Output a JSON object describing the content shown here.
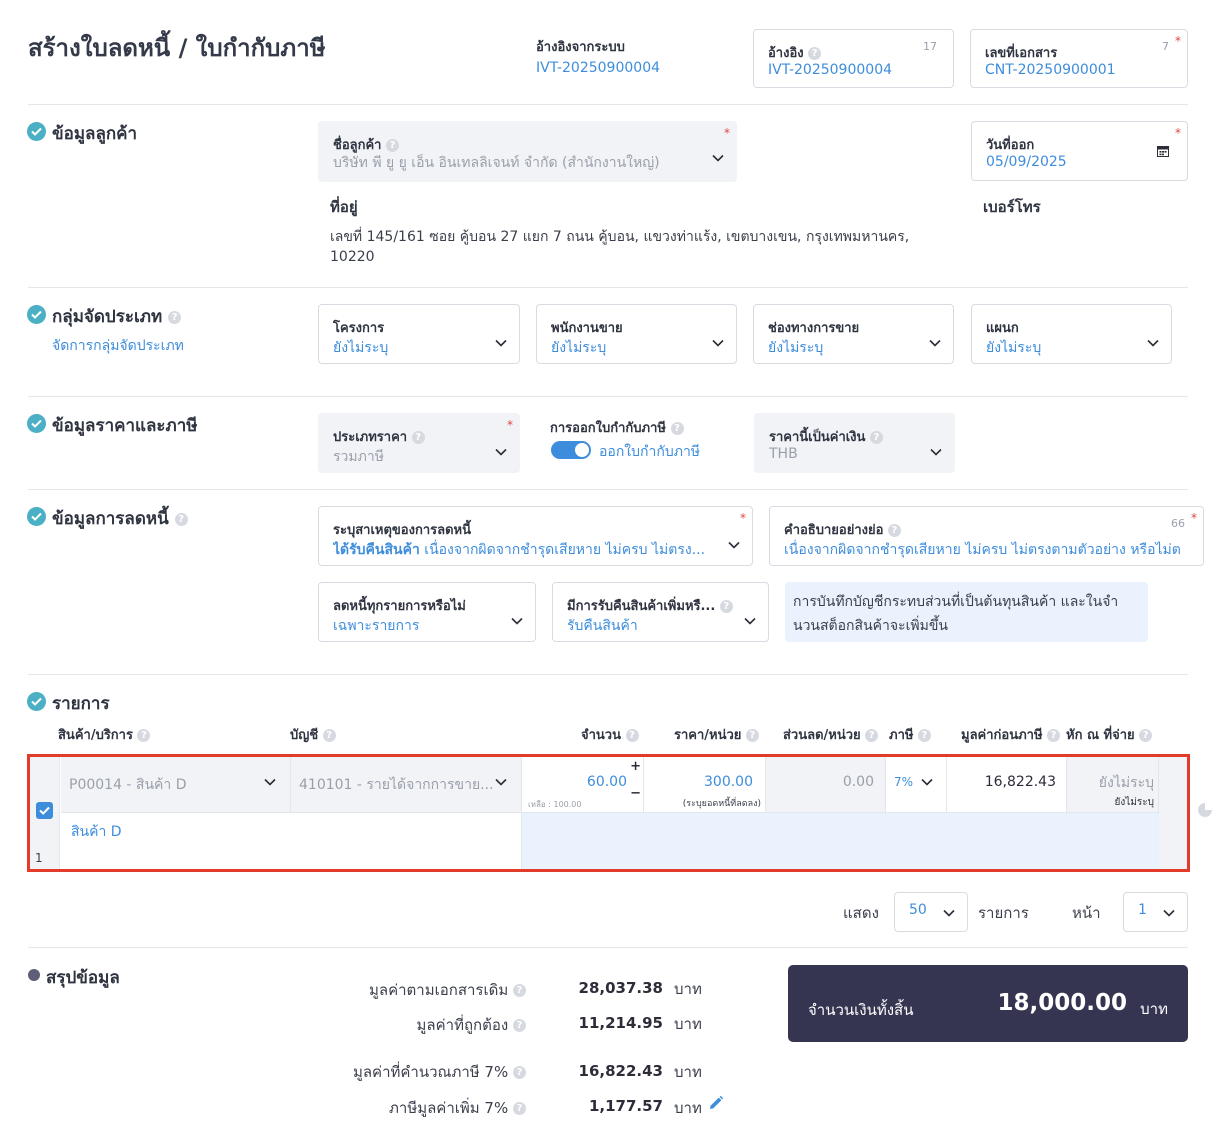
{
  "page_title": "สร้างใบลดหนี้ / ใบกำกับภาษี",
  "header": {
    "system_ref_label": "อ้างอิงจากระบบ",
    "system_ref_value": "IVT-20250900004",
    "ref_label": "อ้างอิง",
    "ref_value": "IVT-20250900004",
    "ref_count": "17",
    "doc_no_label": "เลขที่เอกสาร",
    "doc_no_value": "CNT-20250900001",
    "doc_no_count": "7"
  },
  "customer": {
    "section_title": "ข้อมูลลูกค้า",
    "name_label": "ชื่อลูกค้า",
    "name_value": "บริษัท พี ยู ยู เอ็น อินเทลลิเจนท์ จำกัด (สำนักงานใหญ่)",
    "issue_date_label": "วันที่ออก",
    "issue_date_value": "05/09/2025",
    "address_label": "ที่อยู่",
    "address_line1": "เลขที่ 145/161 ซอย คู้บอน 27 แยก 7 ถนน คู้บอน, แขวงท่าแร้ง, เขตบางเขน, กรุงเทพมหานคร,",
    "address_line2": "10220",
    "phone_label": "เบอร์โทร"
  },
  "classification": {
    "section_title": "กลุ่มจัดประเภท",
    "manage_link": "จัดการกลุ่มจัดประเภท",
    "fields": [
      {
        "label": "โครงการ",
        "value": "ยังไม่ระบุ"
      },
      {
        "label": "พนักงานขาย",
        "value": "ยังไม่ระบุ"
      },
      {
        "label": "ช่องทางการขาย",
        "value": "ยังไม่ระบุ"
      },
      {
        "label": "แผนก",
        "value": "ยังไม่ระบุ"
      }
    ]
  },
  "pricing": {
    "section_title": "ข้อมูลราคาและภาษี",
    "price_type_label": "ประเภทราคา",
    "price_type_value": "รวมภาษี",
    "tax_invoice_label": "การออกใบกำกับภาษี",
    "tax_invoice_toggle": "ออกใบกำกับภาษี",
    "currency_label": "ราคานี้เป็นค่าเงิน",
    "currency_value": "THB"
  },
  "debit": {
    "section_title": "ข้อมูลการลดหนี้",
    "reason_label": "ระบุสาเหตุของการลดหนี้",
    "reason_bold": "ได้รับคืนสินค้า",
    "reason_rest": "เนื่องจากผิดจากชำรุดเสียหาย ไม่ครบ ไม่ตรง...",
    "desc_label": "คำอธิบายอย่างย่อ",
    "desc_count": "66",
    "desc_value": "เนื่องจากผิดจากชำรุดเสียหาย ไม่ครบ ไม่ตรงตามตัวอย่าง หรือไม่ต",
    "all_items_label": "ลดหนี้ทุกรายการหรือไม่",
    "all_items_value": "เฉพาะรายการ",
    "return_label": "มีการรับคืนสินค้าเพิ่มหรื...",
    "return_value": "รับคืนสินค้า",
    "note_line1": "การบันทึกบัญชีกระทบส่วนที่เป็นต้นทุนสินค้า และในจำ",
    "note_line2": "นวนสต็อกสินค้าจะเพิ่มขึ้น"
  },
  "items": {
    "section_title": "รายการ",
    "headers": {
      "product": "สินค้า/บริการ",
      "account": "บัญชี",
      "qty": "จำนวน",
      "price": "ราคา/หน่วย",
      "discount": "ส่วนลด/หน่วย",
      "tax": "ภาษี",
      "pre_tax": "มูลค่าก่อนภาษี",
      "withholding": "หัก ณ ที่จ่าย"
    },
    "rows": [
      {
        "index": "1",
        "product": "P00014 - สินค้า D",
        "account": "410101 - รายได้จากการขาย...",
        "qty": "60.00",
        "qty_left": "เหลือ : 100.00",
        "qty_plus": "+",
        "qty_minus": "−",
        "price": "300.00",
        "price_note": "(ระบุยอดหนี้ที่ลดลง)",
        "discount": "0.00",
        "tax": "7%",
        "pre_tax": "16,822.43",
        "withholding": "ยังไม่ระบุ",
        "withholding_sub": "ยังไม่ระบุ",
        "description": "สินค้า D",
        "checked": true
      }
    ],
    "pagination": {
      "show_label": "แสดง",
      "per_page": "50",
      "items_label": "รายการ",
      "page_label": "หน้า",
      "page": "1"
    }
  },
  "summary": {
    "section_title": "สรุปข้อมูล",
    "rows": [
      {
        "label": "มูลค่าตามเอกสารเดิม",
        "value": "28,037.38",
        "unit": "บาท"
      },
      {
        "label": "มูลค่าที่ถูกต้อง",
        "value": "11,214.95",
        "unit": "บาท"
      },
      {
        "label": "มูลค่าที่คำนวณภาษี 7%",
        "value": "16,822.43",
        "unit": "บาท"
      },
      {
        "label": "ภาษีมูลค่าเพิ่ม 7%",
        "value": "1,177.57",
        "unit": "บาท"
      }
    ],
    "total_label": "จำนวนเงินทั้งสิ้น",
    "total_value": "18,000.00",
    "total_unit": "บาท"
  },
  "colors": {
    "accent": "#3e8ddc",
    "check": "#4bb0c5",
    "highlight_border": "#e23b2a",
    "total_bg": "#353552"
  }
}
